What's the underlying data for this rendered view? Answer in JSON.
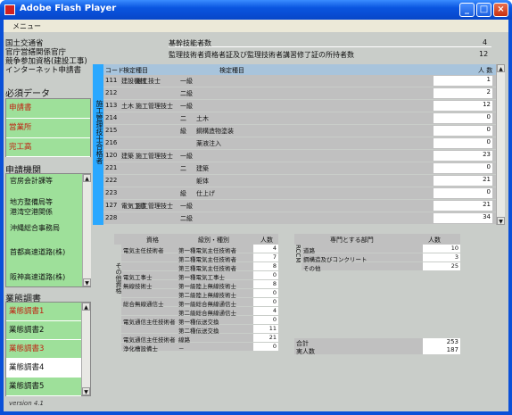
{
  "window": {
    "title": "Adobe Flash Player",
    "menu": "メニュー"
  },
  "agency": [
    "国土交通省",
    "官庁営繕関係官庁",
    "競争参加資格(建設工事)",
    "インターネット申請書"
  ],
  "required": {
    "heading": "必須データ",
    "items": [
      "申請書",
      "営業所",
      "完工高"
    ]
  },
  "apply": {
    "heading": "申請機関",
    "items": [
      "官房会計課等",
      "地方整備局等",
      "港湾空港関係",
      "沖縄総合事務局",
      "首都高速道路(株)",
      "阪神高速道路(株)"
    ]
  },
  "survey": {
    "heading": "業態調書",
    "items": [
      "業態調書1",
      "業態調書2",
      "業態調書3",
      "業態調書4",
      "業態調書5"
    ]
  },
  "version": "version 4.1",
  "top": {
    "row1_label": "基幹技能者数",
    "row1_val": "4",
    "row2_label": "監理技術者資格者証及び監理技術者講習修了証の所持者数",
    "row2_val": "12"
  },
  "main_table": {
    "header": {
      "code": "コード",
      "kind": "検定種目",
      "grade": "検定種目",
      "count": "人 数"
    },
    "side_label": "施工管理技士合格者",
    "rows": [
      {
        "code": "111",
        "k1": "建設機械",
        "k2": "施工技士",
        "g1": "一級",
        "g2": "",
        "n": "1"
      },
      {
        "code": "212",
        "k1": "",
        "k2": "",
        "g1": "二級",
        "g2": "",
        "n": "2"
      },
      {
        "code": "113",
        "k1": "土木",
        "k2": "施工管理技士",
        "g1": "一級",
        "g2": "",
        "n": "12"
      },
      {
        "code": "214",
        "k1": "",
        "k2": "",
        "g1": "二",
        "g2": "土木",
        "n": "0"
      },
      {
        "code": "215",
        "k1": "",
        "k2": "",
        "g1": "",
        "g2": "鋼構造物塗装",
        "n": "0"
      },
      {
        "code": "216",
        "k1": "",
        "k2": "",
        "g1": "",
        "g2": "薬液注入",
        "n": "0"
      },
      {
        "code": "120",
        "k1": "建築",
        "k2": "施工管理技士",
        "g1": "一級",
        "g2": "",
        "n": "23"
      },
      {
        "code": "221",
        "k1": "",
        "k2": "",
        "g1": "二",
        "g2": "建築",
        "n": "0"
      },
      {
        "code": "222",
        "k1": "",
        "k2": "",
        "g1": "",
        "g2": "躯体",
        "n": "21"
      },
      {
        "code": "223",
        "k1": "",
        "k2": "",
        "g1": "",
        "g2": "仕上げ",
        "n": "0"
      },
      {
        "code": "127",
        "k1": "電気工事",
        "k2": "施工管理技士",
        "g1": "一級",
        "g2": "",
        "n": "21"
      },
      {
        "code": "228",
        "k1": "",
        "k2": "",
        "g1": "二級",
        "g2": "",
        "n": "34"
      }
    ],
    "kyu": "級"
  },
  "qual": {
    "header": {
      "c1": "資格",
      "c2": "級別・種別",
      "c3": "人数"
    },
    "side": "その他資格",
    "rows": [
      {
        "name": "電気主任技術者",
        "kind": "第一種電気主任技術者",
        "n": "4"
      },
      {
        "name": "",
        "kind": "第二種電気主任技術者",
        "n": "7"
      },
      {
        "name": "",
        "kind": "第三種電気主任技術者",
        "n": "8"
      },
      {
        "name": "電気工事士",
        "kind": "第一種電気工事士",
        "n": "0"
      },
      {
        "name": "無線技術士",
        "kind": "第一級陸上無線技術士",
        "n": "8"
      },
      {
        "name": "",
        "kind": "第二級陸上無線技術士",
        "n": "0"
      },
      {
        "name": "総合無線通信士",
        "kind": "第一級総合無線通信士",
        "n": "0"
      },
      {
        "name": "",
        "kind": "第二級総合無線通信士",
        "n": "4"
      },
      {
        "name": "電気通信主任技術者",
        "kind": "第一種伝送交換",
        "n": "0"
      },
      {
        "name": "",
        "kind": "第二種伝送交換",
        "n": "11"
      },
      {
        "name": "電気通信主任技術者",
        "kind": "線路",
        "n": "21"
      },
      {
        "name": "浄化槽設備士",
        "kind": "－",
        "n": "0"
      }
    ]
  },
  "rcm": {
    "header": {
      "c1": "専門とする部門",
      "c2": "人数"
    },
    "side": "RCCM",
    "rows": [
      {
        "name": "道路",
        "n": "10"
      },
      {
        "name": "鋼構造及びコンクリート",
        "n": "3"
      },
      {
        "name": "その他",
        "n": "25"
      }
    ],
    "total_label": "合計",
    "total": "253",
    "actual_label": "実人数",
    "actual": "187"
  }
}
